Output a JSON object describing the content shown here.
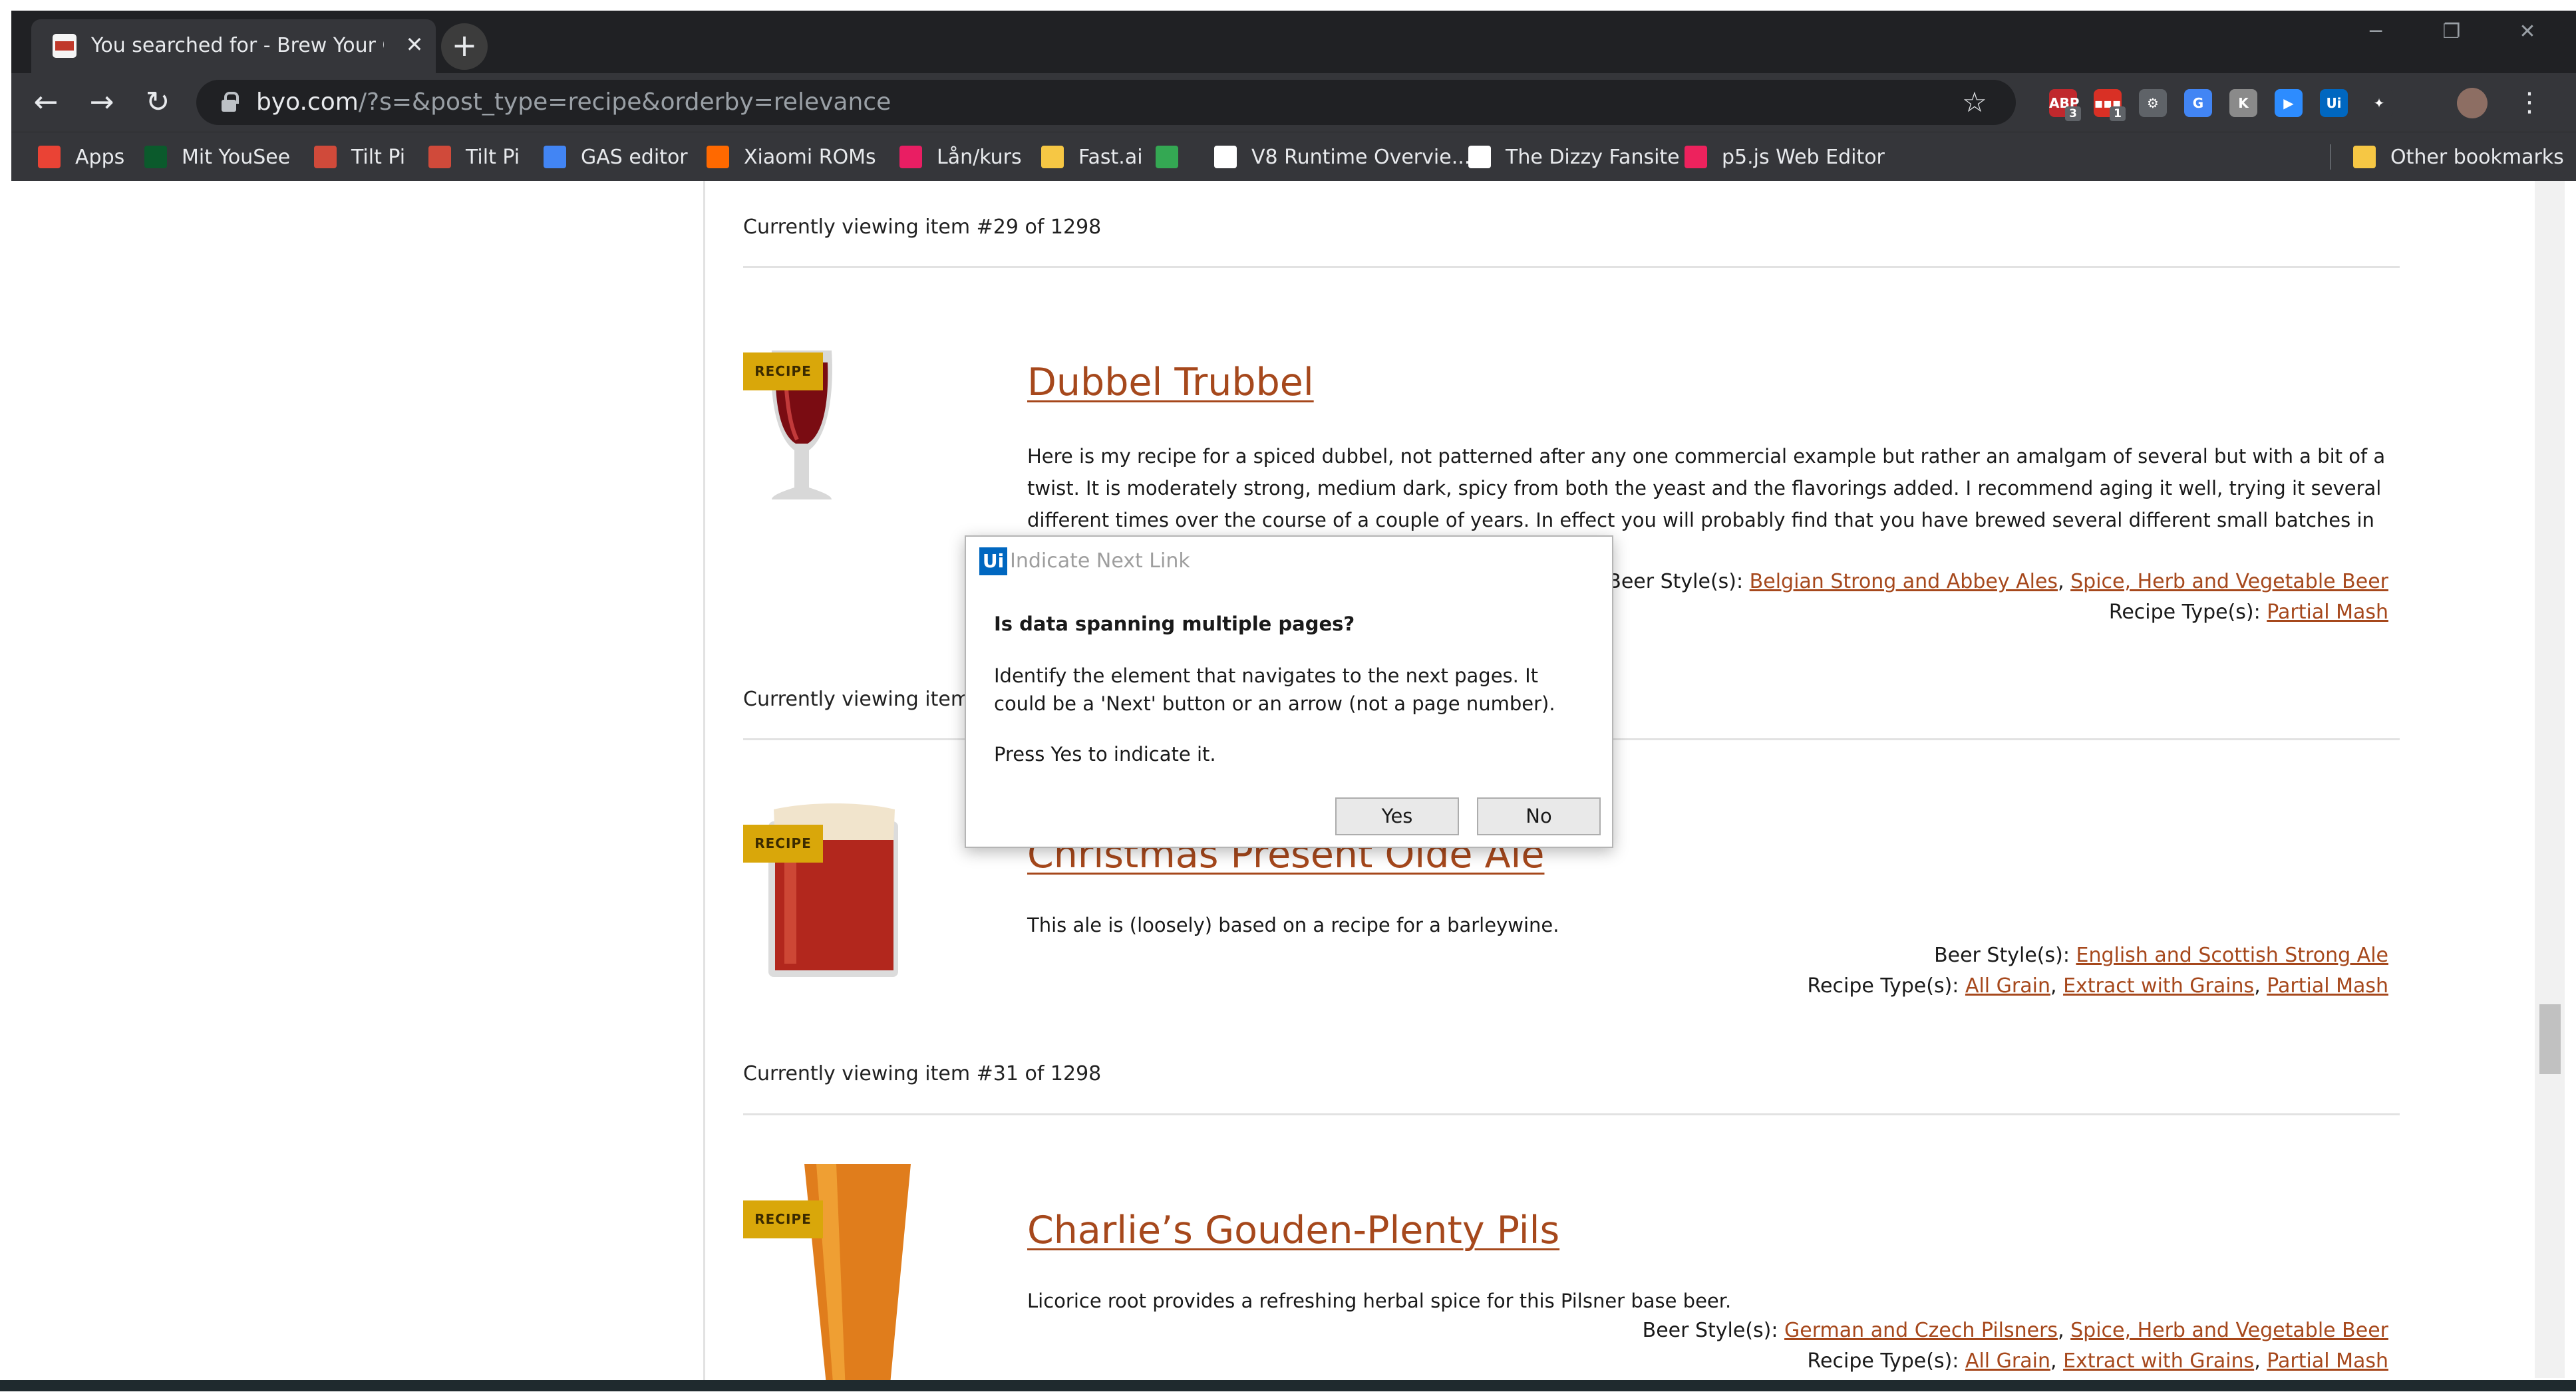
{
  "browser": {
    "tab_title": "You searched for - Brew Your Own",
    "tab_close": "✕",
    "new_tab": "+",
    "url_host": "byo.com",
    "url_path": "/?s=&post_type=recipe&orderby=relevance",
    "window_controls": {
      "minimize": "─",
      "restore": "❐",
      "close": "✕"
    },
    "extensions": [
      {
        "label": "ABP",
        "badge": "3",
        "color": "#c0282d"
      },
      {
        "label": "▪▪▪",
        "badge": "1",
        "color": "#d93025"
      },
      {
        "label": "⚙",
        "badge": "",
        "color": "#5f6368"
      },
      {
        "label": "G",
        "badge": "",
        "color": "#4285f4"
      },
      {
        "label": "K",
        "badge": "",
        "color": "#8a8a8a"
      },
      {
        "label": "▶",
        "badge": "",
        "color": "#2d8cff"
      },
      {
        "label": "Ui",
        "badge": "",
        "color": "#0067c0"
      },
      {
        "label": "✦",
        "badge": "",
        "color": "#35363a"
      }
    ]
  },
  "bookmarks": {
    "items": [
      {
        "label": "Apps",
        "icon": "apps-grid-icon",
        "color": "#ea4335"
      },
      {
        "label": "Mit YouSee",
        "icon": "yousee-icon",
        "color": "#0b5a2c"
      },
      {
        "label": "Tilt Pi",
        "icon": "tilt-pi-icon",
        "color": "#d04a3a"
      },
      {
        "label": "Tilt Pi",
        "icon": "tilt-pi-icon",
        "color": "#d04a3a"
      },
      {
        "label": "GAS editor",
        "icon": "gas-editor-icon",
        "color": "#4285f4"
      },
      {
        "label": "Xiaomi ROMs",
        "icon": "xiaomi-icon",
        "color": "#ff6900"
      },
      {
        "label": "Lån/kurs",
        "icon": "bookmark-icon",
        "color": "#e91e63"
      },
      {
        "label": "Fast.ai",
        "icon": "folder-icon",
        "color": "#f6c744"
      },
      {
        "label": "",
        "icon": "google-drive-icon",
        "color": "#34a853"
      },
      {
        "label": "V8 Runtime Overvie...",
        "icon": "apps-script-icon",
        "color": "#ffffff"
      },
      {
        "label": "The Dizzy Fansite",
        "icon": "globe-icon",
        "color": "#ffffff"
      },
      {
        "label": "p5.js Web Editor",
        "icon": "p5-icon",
        "color": "#ed225d"
      }
    ],
    "other": "Other bookmarks"
  },
  "page": {
    "items": [
      {
        "counter": "Currently viewing item #29 of 1298"
      },
      {
        "badge": "RECIPE",
        "title": "Dubbel Trubbel",
        "description": "Here is my recipe for a spiced dubbel, not patterned after any one commercial example but rather an amalgam of several but with a bit of a twist. It is moderately strong, medium dark, spicy from both the yeast and the flavorings added. I recommend aging it well, trying it several different times over the course of a couple of years. In effect you will probably find that you have brewed several different small batches in one, as the flavors really evolve over",
        "beer_styles_label": "Beer Style(s):",
        "beer_styles": [
          "Belgian Strong and Abbey Ales",
          "Spice, Herb and Vegetable Beer"
        ],
        "recipe_types_label": "Recipe Type(s):",
        "recipe_types": [
          "Partial Mash"
        ]
      },
      {
        "counter": "Currently viewing item #30 of 1298"
      },
      {
        "badge": "RECIPE",
        "title": "Christmas Present Olde Ale",
        "description": "This ale is (loosely) based on a recipe for a barleywine.",
        "beer_styles_label": "Beer Style(s):",
        "beer_styles": [
          "English and Scottish Strong Ale"
        ],
        "recipe_types_label": "Recipe Type(s):",
        "recipe_types": [
          "All Grain",
          "Extract with Grains",
          "Partial Mash"
        ]
      },
      {
        "counter": "Currently viewing item #31 of 1298"
      },
      {
        "badge": "RECIPE",
        "title": "Charlie’s Gouden-Plenty Pils",
        "description": "Licorice root provides a refreshing herbal spice for this Pilsner base beer.",
        "beer_styles_label": "Beer Style(s):",
        "beer_styles": [
          "German and Czech Pilsners",
          "Spice, Herb and Vegetable Beer"
        ],
        "recipe_types_label": "Recipe Type(s):",
        "recipe_types": [
          "All Grain",
          "Extract with Grains",
          "Partial Mash"
        ]
      }
    ]
  },
  "dialog": {
    "logo": "Ui",
    "title": "Indicate Next Link",
    "question": "Is data spanning multiple pages?",
    "body": "Identify the element that navigates to the next pages. It could be a 'Next' button or an arrow (not a page number).",
    "instruction": "Press Yes to indicate it.",
    "yes": "Yes",
    "no": "No"
  }
}
